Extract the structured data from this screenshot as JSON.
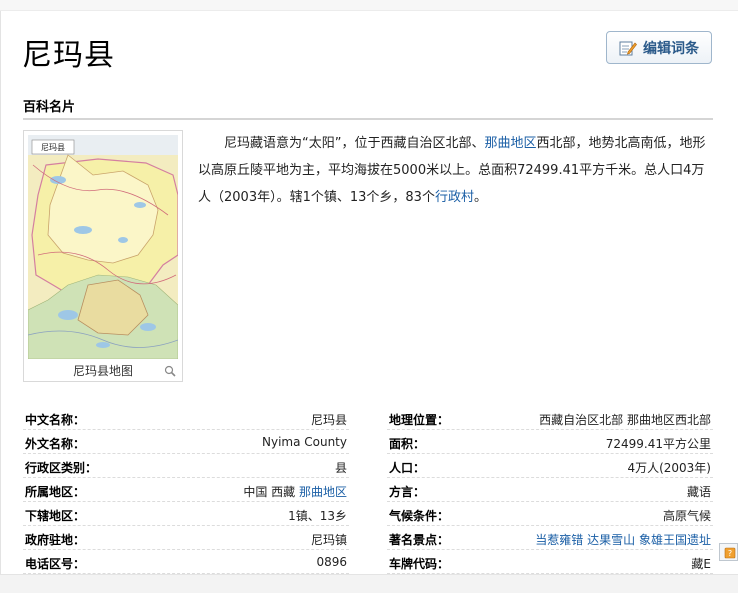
{
  "page": {
    "title": "尼玛县",
    "edit_label": "编辑词条",
    "section_title": "百科名片"
  },
  "map_card": {
    "map_label": "尼玛县",
    "caption": "尼玛县地图",
    "icon": "magnifier-icon"
  },
  "summary": {
    "p1": "尼玛藏语意为“太阳”，位于西藏自治区北部、",
    "link1": "那曲地区",
    "p2": "西北部，地势北高南低，地形以高原丘陵平地为主，平均海拔在5000米以上。总面积72499.41平方千米。总人口4万人（2003年）。辖1个镇、13个乡，83个",
    "link2": "行政村",
    "p3": "。"
  },
  "info_left": [
    {
      "key": "中文名称：",
      "value": "尼玛县"
    },
    {
      "key": "外文名称：",
      "value": "Nyima County"
    },
    {
      "key": "行政区类别：",
      "value": "县"
    },
    {
      "key": "所属地区：",
      "value": "中国 西藏",
      "link": "那曲地区"
    },
    {
      "key": "下辖地区：",
      "value": "1镇、13乡"
    },
    {
      "key": "政府驻地：",
      "value": "尼玛镇"
    },
    {
      "key": "电话区号：",
      "value": "0896"
    }
  ],
  "info_right": [
    {
      "key": "地理位置：",
      "value": "西藏自治区北部 那曲地区西北部"
    },
    {
      "key": "面积：",
      "value": "72499.41平方公里"
    },
    {
      "key": "人口：",
      "value": "4万人(2003年)"
    },
    {
      "key": "方言：",
      "value": "藏语"
    },
    {
      "key": "气候条件：",
      "value": "高原气候"
    },
    {
      "key": "著名景点：",
      "links": [
        "当惹雍错",
        "达果雪山",
        "象雄王国遗址"
      ]
    },
    {
      "key": "车牌代码：",
      "value": "藏E"
    }
  ],
  "colors": {
    "link": "#1b5fa6",
    "edit_text": "#2b5a8a",
    "edit_border": "#9fb6cc"
  }
}
